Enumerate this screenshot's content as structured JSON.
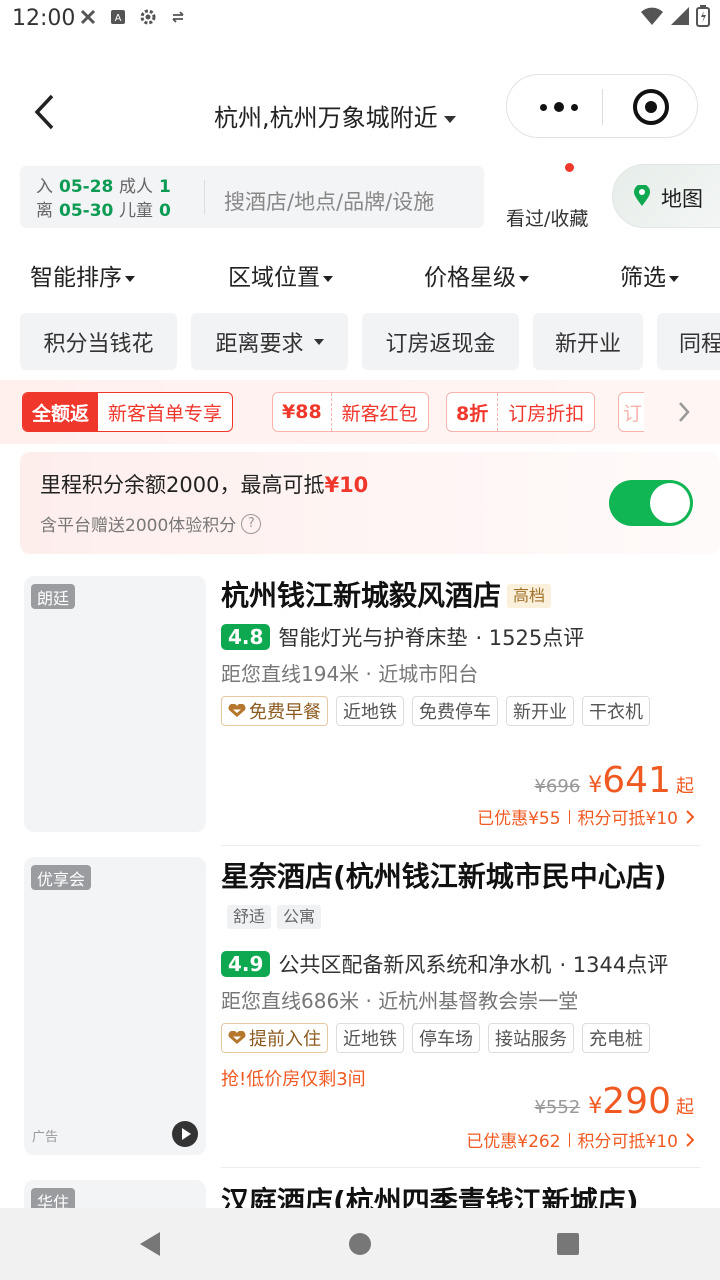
{
  "status_bar": {
    "time": "12:00"
  },
  "header": {
    "location": "杭州,杭州万象城附近"
  },
  "search": {
    "checkin_label": "入",
    "checkin_date": "05-28",
    "checkout_label": "离",
    "checkout_date": "05-30",
    "adults_label": "成人",
    "adults": "1",
    "children_label": "儿童",
    "children": "0",
    "placeholder": "搜酒店/地点/品牌/设施",
    "favorites_label": "看过/收藏",
    "map_label": "地图"
  },
  "sort": {
    "items": [
      "智能排序",
      "区域位置",
      "价格星级",
      "筛选"
    ]
  },
  "chips": [
    "积分当钱花",
    "距离要求",
    "订房返现金",
    "新开业",
    "同程"
  ],
  "promos": [
    {
      "head": "全额返",
      "body": "新客首单专享"
    },
    {
      "head": "¥88",
      "body": "新客红包"
    },
    {
      "head": "8折",
      "body": "订房折扣"
    },
    {
      "head": "订",
      "body": ""
    }
  ],
  "points": {
    "title": "里程积分余额2000，最高可抵",
    "amount": "¥10",
    "subtitle": "含平台赠送2000体验积分",
    "toggle_on": true
  },
  "hotels": [
    {
      "badge": "朗廷",
      "name": "杭州钱江新城毅风酒店",
      "tiers": [
        "高档"
      ],
      "score": "4.8",
      "highlight": "智能灯光与护脊床垫",
      "reviews": "· 1525点评",
      "distance": "距您直线194米 · 近城市阳台",
      "special_tag": "免费早餐",
      "tags": [
        "近地铁",
        "免费停车",
        "新开业",
        "干衣机"
      ],
      "urgency": "",
      "orig_price": "¥696",
      "currency": "¥",
      "price": "641",
      "price_suffix": "起",
      "discount": "已优惠¥55",
      "points_offset": "积分可抵¥10"
    },
    {
      "badge": "优享会",
      "name": "星奈酒店(杭州钱江新城市民中心店)",
      "tiers": [
        "舒适",
        "公寓"
      ],
      "score": "4.9",
      "highlight": "公共区配备新风系统和净水机",
      "reviews": "· 1344点评",
      "distance": "距您直线686米 · 近杭州基督教会崇一堂",
      "special_tag": "提前入住",
      "tags": [
        "近地铁",
        "停车场",
        "接站服务",
        "充电桩"
      ],
      "urgency": "抢!低价房仅剩3间",
      "orig_price": "¥552",
      "currency": "¥",
      "price": "290",
      "price_suffix": "起",
      "discount": "已优惠¥262",
      "points_offset": "积分可抵¥10",
      "ad_label": "广告"
    },
    {
      "badge": "华住",
      "name": "汉庭酒店(杭州四季青钱江新城店)"
    }
  ],
  "colors": {
    "accent_green": "#0ea851",
    "price_orange": "#f05a22",
    "promo_red": "#f0372c"
  }
}
